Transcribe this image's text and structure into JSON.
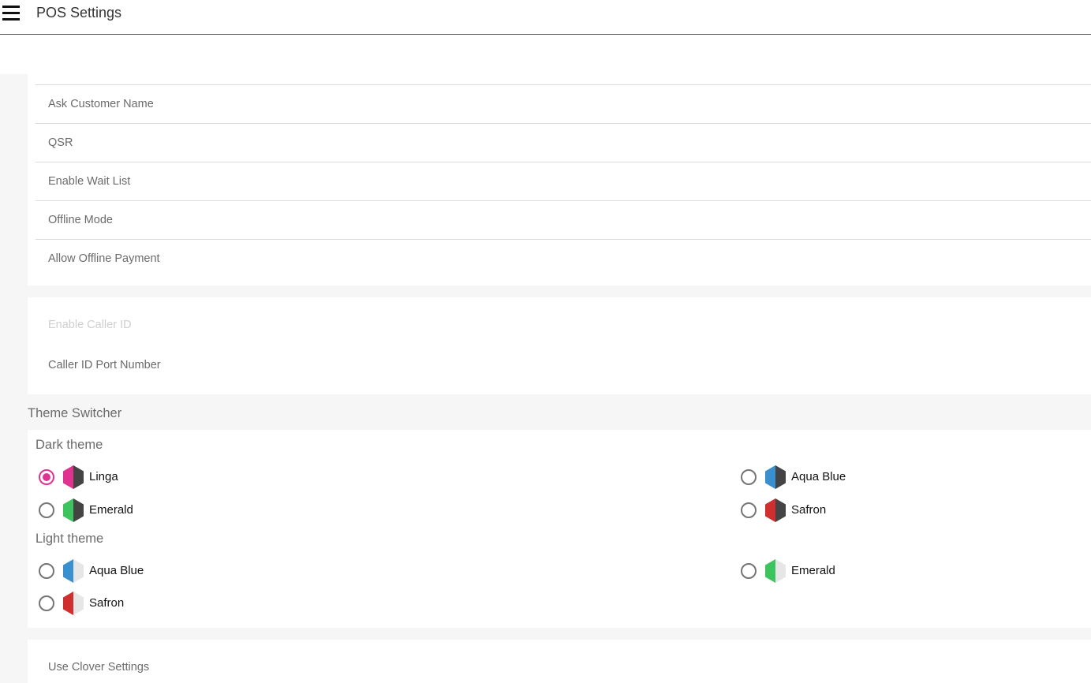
{
  "header": {
    "title": "POS Settings",
    "menu_icon": "hamburger-icon"
  },
  "settings_list": [
    {
      "label": "Ask Customer Name"
    },
    {
      "label": "QSR"
    },
    {
      "label": "Enable Wait List"
    },
    {
      "label": "Offline Mode"
    },
    {
      "label": "Allow Offline Payment"
    }
  ],
  "caller_id": {
    "enable_label": "Enable Caller ID",
    "port_label": "Caller ID Port Number"
  },
  "theme_switcher": {
    "title": "Theme Switcher",
    "selected": "dark-linga",
    "dark": {
      "title": "Dark theme",
      "options": [
        {
          "name": "Linga",
          "color": "#e0338f",
          "selected": true
        },
        {
          "name": "Aqua Blue",
          "color": "#3a8fcf",
          "selected": false
        },
        {
          "name": "Emerald",
          "color": "#3ec45e",
          "selected": false
        },
        {
          "name": "Safron",
          "color": "#cf2f2f",
          "selected": false
        }
      ],
      "base_color": "#444444"
    },
    "light": {
      "title": "Light theme",
      "options": [
        {
          "name": "Aqua Blue",
          "color": "#3a8fcf",
          "selected": false
        },
        {
          "name": "Emerald",
          "color": "#3ec45e",
          "selected": false
        },
        {
          "name": "Safron",
          "color": "#cf2f2f",
          "selected": false
        }
      ],
      "base_color": "#e6e6e6"
    }
  },
  "clover": {
    "label": "Use Clover Settings"
  }
}
